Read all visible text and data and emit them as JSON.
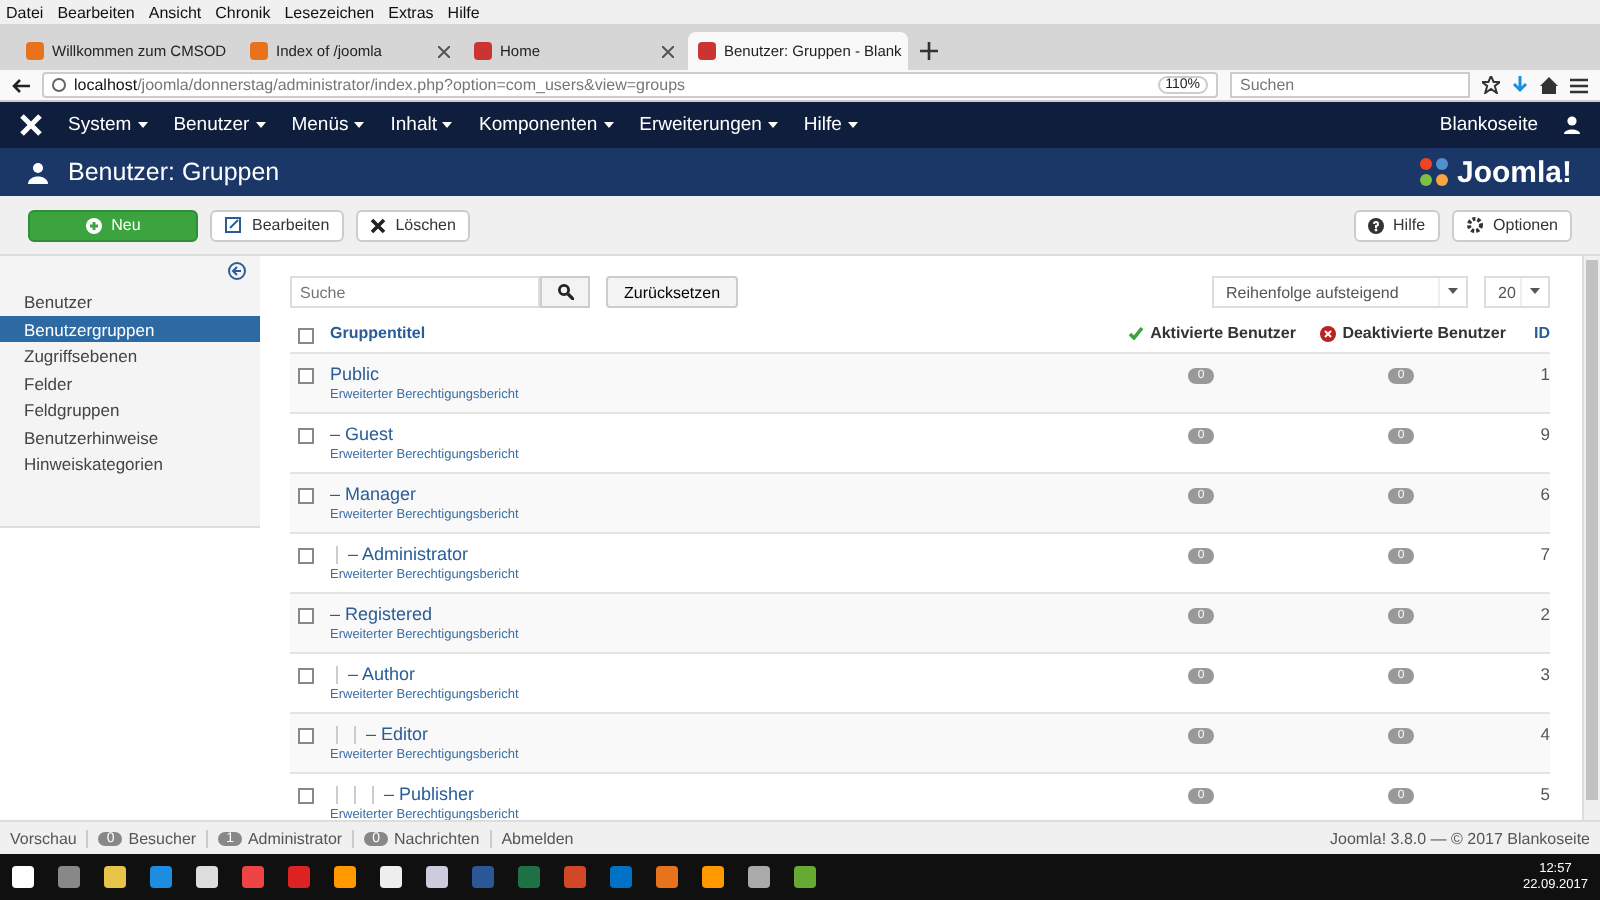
{
  "browser": {
    "menu": [
      "Datei",
      "Bearbeiten",
      "Ansicht",
      "Chronik",
      "Lesezeichen",
      "Extras",
      "Hilfe"
    ],
    "tabs": [
      {
        "label": "Willkommen zum CMSOD",
        "selected": false
      },
      {
        "label": "Index of /joomla",
        "selected": false
      },
      {
        "label": "Home",
        "selected": false
      },
      {
        "label": "Benutzer: Gruppen - Blank",
        "selected": true
      }
    ],
    "url_host": "localhost",
    "url_path": "/joomla/donnerstag/administrator/index.php?option=com_users&view=groups",
    "zoom": "110%",
    "search": {
      "placeholder": "Suchen"
    }
  },
  "nav": {
    "items": [
      "System",
      "Benutzer",
      "Menüs",
      "Inhalt",
      "Komponenten",
      "Erweiterungen",
      "Hilfe"
    ],
    "site_link": "Blankoseite"
  },
  "header": {
    "title": "Benutzer: Gruppen",
    "logo": "Joomla!"
  },
  "toolbar": {
    "buttons": [
      {
        "label": "Neu",
        "kind": "primary"
      },
      {
        "label": "Bearbeiten",
        "kind": "edit"
      },
      {
        "label": "Löschen",
        "kind": "delete"
      }
    ],
    "right_buttons": [
      {
        "label": "Hilfe",
        "kind": "help"
      },
      {
        "label": "Optionen",
        "kind": "options"
      }
    ]
  },
  "sidebar": {
    "items": [
      {
        "label": "Benutzer",
        "selected": false
      },
      {
        "label": "Benutzergruppen",
        "selected": true
      },
      {
        "label": "Zugriffsebenen",
        "selected": false
      },
      {
        "label": "Felder",
        "selected": false
      },
      {
        "label": "Feldgruppen",
        "selected": false
      },
      {
        "label": "Benutzerhinweise",
        "selected": false
      },
      {
        "label": "Hinweiskategorien",
        "selected": false
      }
    ]
  },
  "filter": {
    "search": {
      "placeholder": "Suche"
    },
    "reset": "Zurücksetzen",
    "ordering": "Reihenfolge aufsteigend",
    "limit": "20"
  },
  "table": {
    "select_all_checked": false,
    "columns": [
      "Gruppentitel",
      "Aktivierte Benutzer",
      "Deaktivierte Benutzer",
      "ID"
    ],
    "rows": [
      {
        "title": "Public",
        "link": "Erweiterter Berechtigungsbericht",
        "active": "0",
        "inactive": "0",
        "id": "1",
        "checked": false,
        "children": [
          {
            "title": "– Guest",
            "link": "Erweiterter Berechtigungsbericht",
            "active": "0",
            "inactive": "0",
            "id": "9",
            "checked": false
          },
          {
            "title": "– Manager",
            "link": "Erweiterter Berechtigungsbericht",
            "active": "0",
            "inactive": "0",
            "id": "6",
            "checked": false,
            "children": [
              {
                "title": "– Administrator",
                "link": "Erweiterter Berechtigungsbericht",
                "active": "0",
                "inactive": "0",
                "id": "7",
                "checked": false
              }
            ]
          },
          {
            "title": "– Registered",
            "link": "Erweiterter Berechtigungsbericht",
            "active": "0",
            "inactive": "0",
            "id": "2",
            "checked": false,
            "children": [
              {
                "title": "– Author",
                "link": "Erweiterter Berechtigungsbericht",
                "active": "0",
                "inactive": "0",
                "id": "3",
                "checked": false,
                "children": [
                  {
                    "title": "– Editor",
                    "link": "Erweiterter Berechtigungsbericht",
                    "active": "0",
                    "inactive": "0",
                    "id": "4",
                    "checked": false,
                    "children": [
                      {
                        "title": "– Publisher",
                        "link": "Erweiterter Berechtigungsbericht",
                        "active": "0",
                        "inactive": "0",
                        "id": "5",
                        "checked": false
                      }
                    ]
                  }
                ]
              }
            ]
          }
        ]
      }
    ]
  },
  "status": {
    "preview": "Vorschau",
    "badges": [
      {
        "count": "0",
        "label": "Besucher"
      },
      {
        "count": "1",
        "label": "Administrator"
      },
      {
        "count": "0",
        "label": "Nachrichten"
      }
    ],
    "logout": "Abmelden",
    "copyright": "Joomla! 3.8.0 — © 2017 Blankoseite"
  },
  "taskbar": {
    "time": "12:57",
    "date": "22.09.2017"
  }
}
